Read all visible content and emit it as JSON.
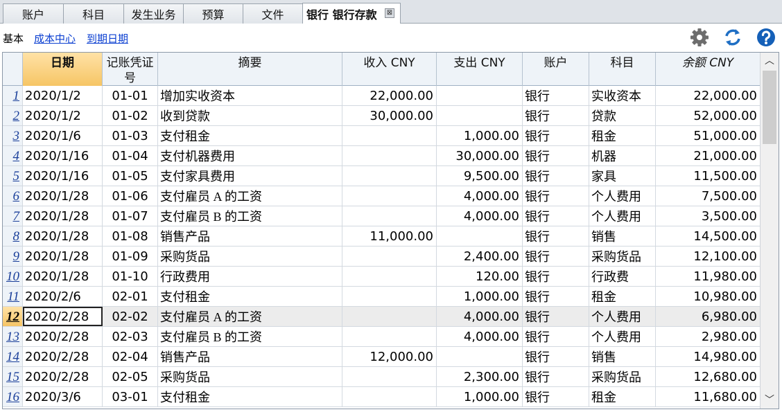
{
  "tabs": [
    {
      "label": "账户"
    },
    {
      "label": "科目"
    },
    {
      "label": "发生业务"
    },
    {
      "label": "预算"
    },
    {
      "label": "文件"
    },
    {
      "label": "银行 银行存款",
      "active": true
    }
  ],
  "tab_close_glyph": "⊠",
  "subbar": {
    "items": [
      "基本",
      "成本中心",
      "到期日期"
    ],
    "icons": [
      "gear-icon",
      "refresh-icon",
      "help-icon"
    ]
  },
  "colors": {
    "accent_header": "#f6c565",
    "link": "#0b3fd1",
    "icon_gray": "#6d6d6d",
    "icon_blue": "#1f6fc4",
    "help_blue": "#1560b8"
  },
  "table": {
    "headers": {
      "date": "日期",
      "voucher_line1": "记账凭证",
      "voucher_line2": "号",
      "desc": "摘要",
      "income": "收入 CNY",
      "expense": "支出 CNY",
      "account": "账户",
      "category": "科目",
      "balance": "余额 CNY"
    },
    "selected_row": 12,
    "rows": [
      {
        "n": "1",
        "date": "2020/1/2",
        "doc": "01-01",
        "desc": "增加实收资本",
        "income": "22,000.00",
        "expense": "",
        "account": "银行",
        "category": "实收资本",
        "balance": "22,000.00"
      },
      {
        "n": "2",
        "date": "2020/1/2",
        "doc": "01-02",
        "desc": "收到贷款",
        "income": "30,000.00",
        "expense": "",
        "account": "银行",
        "category": "贷款",
        "balance": "52,000.00"
      },
      {
        "n": "3",
        "date": "2020/1/6",
        "doc": "01-03",
        "desc": "支付租金",
        "income": "",
        "expense": "1,000.00",
        "account": "银行",
        "category": "租金",
        "balance": "51,000.00"
      },
      {
        "n": "4",
        "date": "2020/1/16",
        "doc": "01-04",
        "desc": "支付机器费用",
        "income": "",
        "expense": "30,000.00",
        "account": "银行",
        "category": "机器",
        "balance": "21,000.00"
      },
      {
        "n": "5",
        "date": "2020/1/16",
        "doc": "01-05",
        "desc": "支付家具费用",
        "income": "",
        "expense": "9,500.00",
        "account": "银行",
        "category": "家具",
        "balance": "11,500.00"
      },
      {
        "n": "6",
        "date": "2020/1/28",
        "doc": "01-06",
        "desc": "支付雇员 A 的工资",
        "income": "",
        "expense": "4,000.00",
        "account": "银行",
        "category": "个人费用",
        "balance": "7,500.00"
      },
      {
        "n": "7",
        "date": "2020/1/28",
        "doc": "01-07",
        "desc": "支付雇员 B 的工资",
        "income": "",
        "expense": "4,000.00",
        "account": "银行",
        "category": "个人费用",
        "balance": "3,500.00"
      },
      {
        "n": "8",
        "date": "2020/1/28",
        "doc": "01-08",
        "desc": "销售产品",
        "income": "11,000.00",
        "expense": "",
        "account": "银行",
        "category": "销售",
        "balance": "14,500.00"
      },
      {
        "n": "9",
        "date": "2020/1/28",
        "doc": "01-09",
        "desc": "采购货品",
        "income": "",
        "expense": "2,400.00",
        "account": "银行",
        "category": "采购货品",
        "balance": "12,100.00"
      },
      {
        "n": "10",
        "date": "2020/1/28",
        "doc": "01-10",
        "desc": "行政费用",
        "income": "",
        "expense": "120.00",
        "account": "银行",
        "category": "行政费",
        "balance": "11,980.00"
      },
      {
        "n": "11",
        "date": "2020/2/6",
        "doc": "02-01",
        "desc": "支付租金",
        "income": "",
        "expense": "1,000.00",
        "account": "银行",
        "category": "租金",
        "balance": "10,980.00"
      },
      {
        "n": "12",
        "date": "2020/2/28",
        "doc": "02-02",
        "desc": "支付雇员 A 的工资",
        "income": "",
        "expense": "4,000.00",
        "account": "银行",
        "category": "个人费用",
        "balance": "6,980.00"
      },
      {
        "n": "13",
        "date": "2020/2/28",
        "doc": "02-03",
        "desc": "支付雇员 B 的工资",
        "income": "",
        "expense": "4,000.00",
        "account": "银行",
        "category": "个人费用",
        "balance": "2,980.00"
      },
      {
        "n": "14",
        "date": "2020/2/28",
        "doc": "02-04",
        "desc": "销售产品",
        "income": "12,000.00",
        "expense": "",
        "account": "银行",
        "category": "销售",
        "balance": "14,980.00"
      },
      {
        "n": "15",
        "date": "2020/2/28",
        "doc": "02-05",
        "desc": "采购货品",
        "income": "",
        "expense": "2,300.00",
        "account": "银行",
        "category": "采购货品",
        "balance": "12,680.00"
      },
      {
        "n": "16",
        "date": "2020/3/6",
        "doc": "03-01",
        "desc": "支付租金",
        "income": "",
        "expense": "1,000.00",
        "account": "银行",
        "category": "租金",
        "balance": "11,680.00"
      }
    ]
  },
  "scrollbar": {
    "up_glyph": "︿",
    "down_glyph": "﹀"
  }
}
